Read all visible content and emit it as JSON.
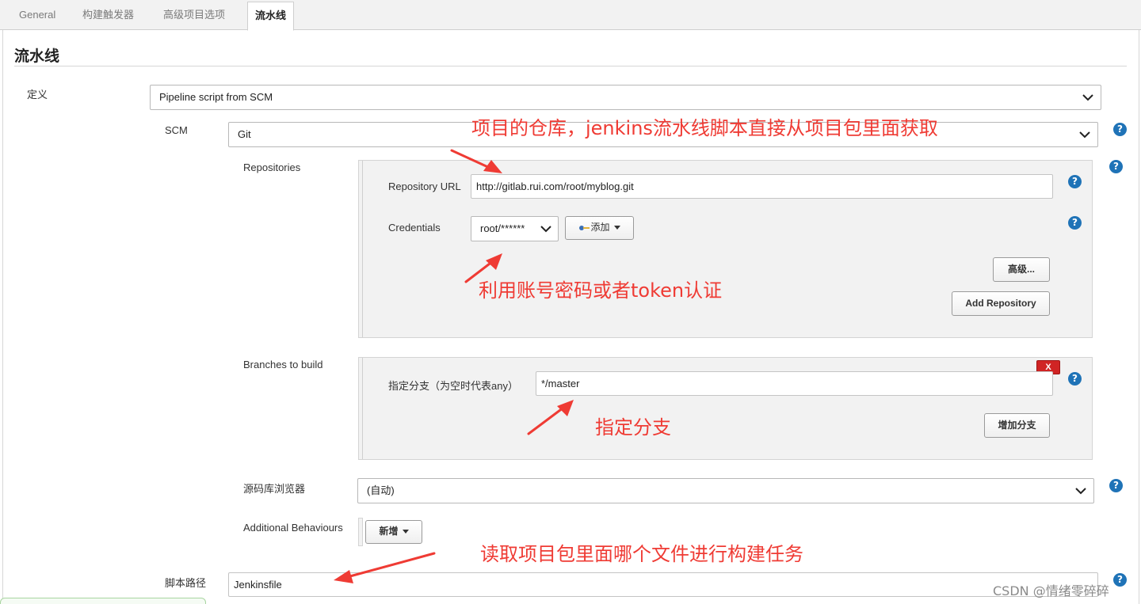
{
  "tabs": [
    {
      "label": "General"
    },
    {
      "label": "构建触发器"
    },
    {
      "label": "高级项目选项"
    },
    {
      "label": "流水线",
      "active": true
    }
  ],
  "section": {
    "title": "流水线"
  },
  "definition": {
    "label": "定义",
    "value": "Pipeline script from SCM"
  },
  "scm": {
    "label": "SCM",
    "value": "Git"
  },
  "repositories": {
    "label": "Repositories",
    "url_label": "Repository URL",
    "url_value": "http://gitlab.rui.com/root/myblog.git",
    "credentials_label": "Credentials",
    "credentials_value": "root/******",
    "add_button": "添加",
    "advanced_button": "高级...",
    "add_repository_button": "Add Repository"
  },
  "branches": {
    "label": "Branches to build",
    "branch_label": "指定分支（为空时代表any）",
    "branch_value": "*/master",
    "delete_button": "X",
    "add_branch_button": "增加分支"
  },
  "browser": {
    "label": "源码库浏览器",
    "value": "(自动)"
  },
  "behaviours": {
    "label": "Additional Behaviours",
    "add_button": "新增"
  },
  "script_path": {
    "label": "脚本路径",
    "value": "Jenkinsfile"
  },
  "help_glyph": "?",
  "annotations": {
    "repo_note": "项目的仓库，jenkins流水线脚本直接从项目包里面获取",
    "cred_note": "利用账号密码或者token认证",
    "branch_note": "指定分支",
    "script_note": "读取项目包里面哪个文件进行构建任务"
  },
  "watermark": "CSDN @情绪零碎碎",
  "colors": {
    "accent_help": "#1f73b7",
    "annotation": "#ef3b34",
    "delete": "#d02424"
  }
}
